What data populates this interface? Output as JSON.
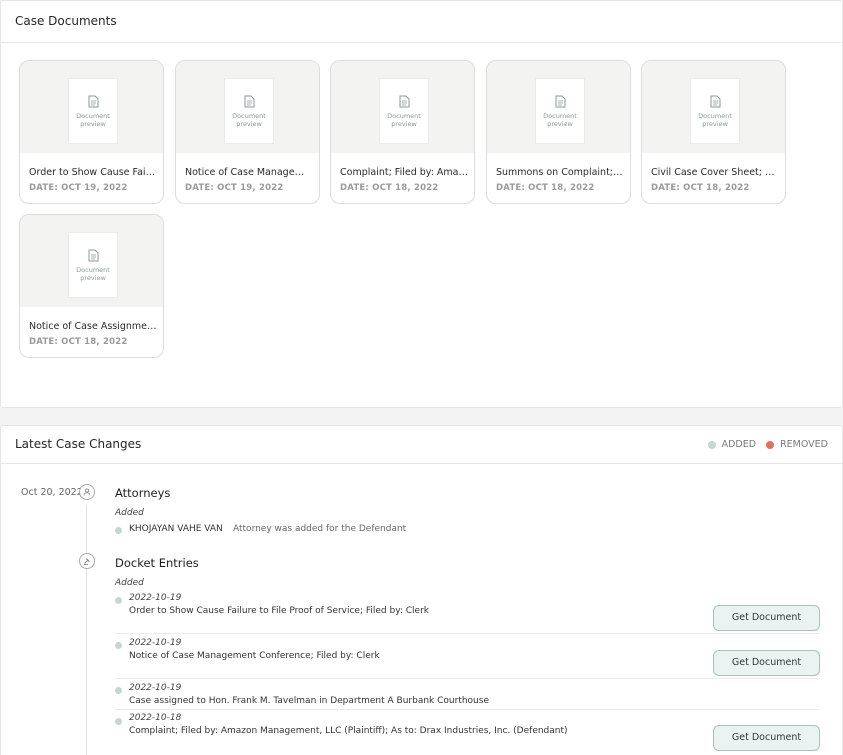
{
  "documents_panel": {
    "title": "Case Documents",
    "preview_label": [
      "Document",
      "preview"
    ],
    "cards": [
      {
        "title": "Order to Show Cause Failure to File Proof of Service",
        "date": "DATE: OCT 19, 2022"
      },
      {
        "title": "Notice of Case Management Conference",
        "date": "DATE: OCT 19, 2022"
      },
      {
        "title": "Complaint; Filed by: Amazon Management, LLC",
        "date": "DATE: OCT 18, 2022"
      },
      {
        "title": "Summons on Complaint; Issued",
        "date": "DATE: OCT 18, 2022"
      },
      {
        "title": "Civil Case Cover Sheet; Filed by: Amazon",
        "date": "DATE: OCT 18, 2022"
      },
      {
        "title": "Notice of Case Assignment - Unlimited Civil Case",
        "date": "DATE: OCT 18, 2022"
      }
    ]
  },
  "changes_panel": {
    "title": "Latest Case Changes",
    "legend": {
      "added_label": "ADDED",
      "removed_label": "REMOVED",
      "added_color": "#c9d6d0",
      "removed_color": "#e07060"
    },
    "date": "Oct 20, 2022",
    "attorneys": {
      "heading": "Attorneys",
      "added_label": "Added",
      "entries": [
        {
          "name": "KHOJAYAN VAHE VAN",
          "note": "Attorney was added for the Defendant"
        }
      ]
    },
    "docket": {
      "heading": "Docket Entries",
      "added_label": "Added",
      "button_label": "Get Document",
      "entries": [
        {
          "date": "2022-10-19",
          "desc": "Order to Show Cause Failure to File Proof of Service; Filed by: Clerk"
        },
        {
          "date": "2022-10-19",
          "desc": "Notice of Case Management Conference; Filed by: Clerk"
        },
        {
          "date": "2022-10-19",
          "desc": "Case assigned to Hon. Frank M. Tavelman in Department A Burbank Courthouse"
        },
        {
          "date": "2022-10-18",
          "desc": "Complaint; Filed by: Amazon Management, LLC (Plaintiff); As to: Drax Industries, Inc. (Defendant)"
        }
      ]
    }
  }
}
